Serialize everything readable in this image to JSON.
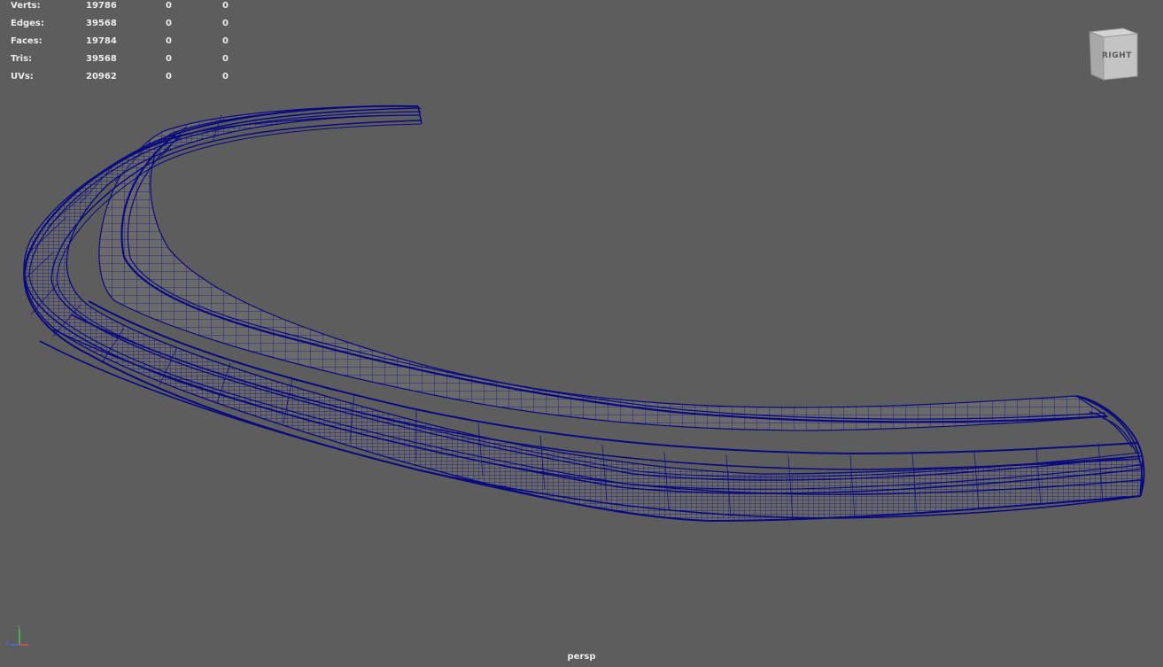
{
  "hud": {
    "rows": [
      {
        "label": "Verts:",
        "v1": "19786",
        "v2": "0",
        "v3": "0"
      },
      {
        "label": "Edges:",
        "v1": "39568",
        "v2": "0",
        "v3": "0"
      },
      {
        "label": "Faces:",
        "v1": "19784",
        "v2": "0",
        "v3": "0"
      },
      {
        "label": "Tris:",
        "v1": "39568",
        "v2": "0",
        "v3": "0"
      },
      {
        "label": "UVs:",
        "v1": "20962",
        "v2": "0",
        "v3": "0"
      }
    ]
  },
  "viewcube": {
    "face_label": "RIGHT"
  },
  "camera": {
    "name": "persp"
  },
  "axis": {
    "x_label": "",
    "y_label": "Y",
    "z_label": "Z"
  },
  "colors": {
    "background": "#5d5d5d",
    "wireframe": "#0a0a80",
    "surface": "#6b6b6b",
    "hud_text": "#ebebeb"
  },
  "icons": {
    "viewcube": "view-cube-icon",
    "axis": "axis-gizmo-icon"
  }
}
